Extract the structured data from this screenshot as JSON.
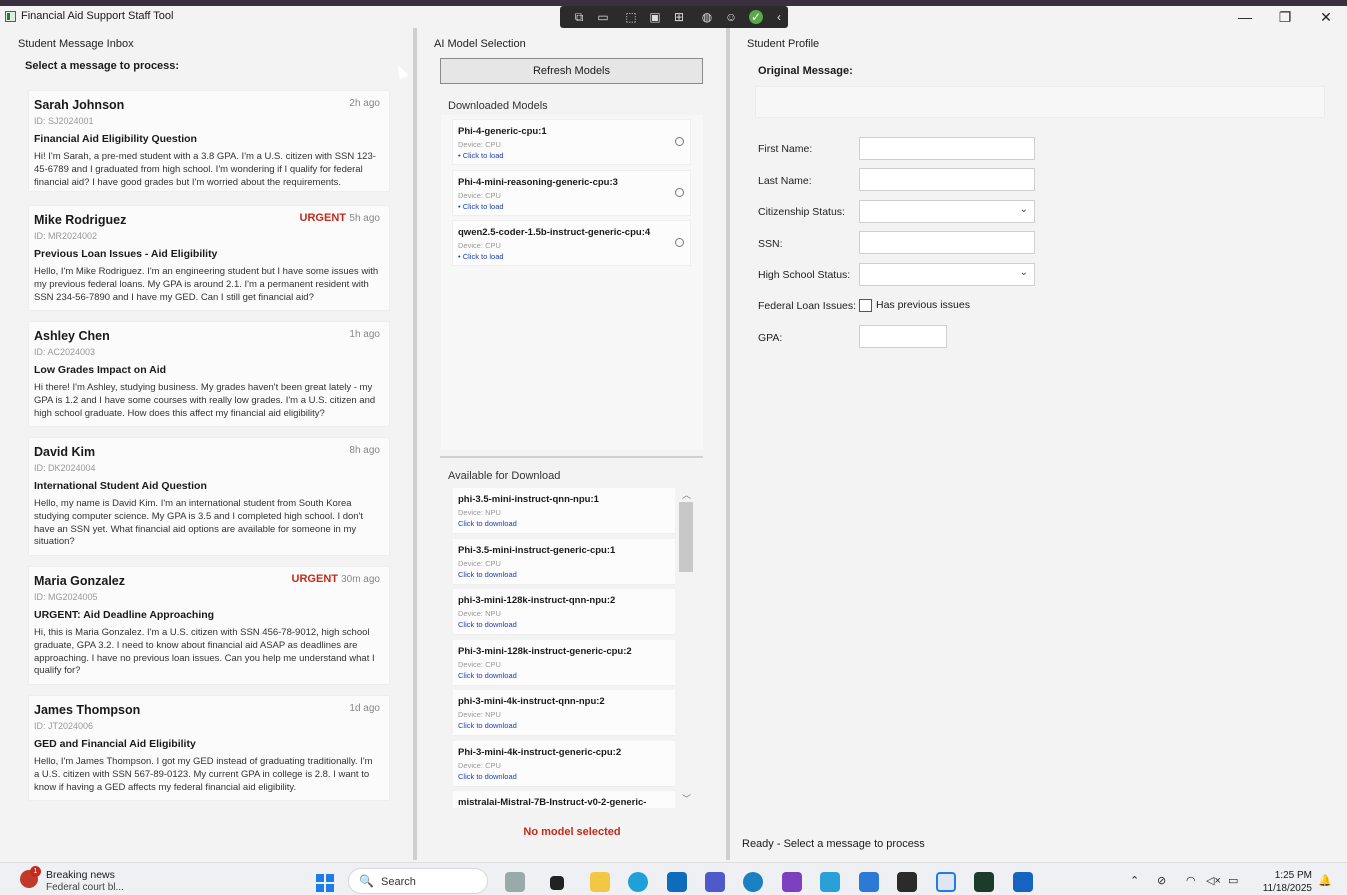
{
  "window": {
    "title": "Financial Aid Support Staff Tool",
    "minimize_glyph": "—",
    "restore_glyph": "❐",
    "close_glyph": "✕"
  },
  "capture_toolbar": {
    "icons": [
      "screen-record-icon",
      "camera-icon",
      "cursor-select-icon",
      "region-icon",
      "window-capture-icon",
      "mic-off-icon",
      "accessibility-icon",
      "check-icon",
      "collapse-icon"
    ]
  },
  "inbox": {
    "pane_label": "Student Message Inbox",
    "heading": "Select a message to process:",
    "urgent_label": "URGENT",
    "messages": [
      {
        "name": "Sarah Johnson",
        "id": "ID: SJ2024001",
        "time": "2h ago",
        "urgent": false,
        "subject": "Financial Aid Eligibility Question",
        "body": "Hi! I'm Sarah, a pre-med student with a 3.8 GPA. I'm a U.S. citizen with SSN 123-45-6789 and I graduated from high school. I'm wondering if I qualify for federal financial aid? I have good grades but I'm worried about the requirements."
      },
      {
        "name": "Mike Rodriguez",
        "id": "ID: MR2024002",
        "time": "5h ago",
        "urgent": true,
        "subject": "Previous Loan Issues - Aid Eligibility",
        "body": "Hello, I'm Mike Rodriguez. I'm an engineering student but I have some issues with my previous federal loans. My GPA is around 2.1. I'm a permanent resident with SSN 234-56-7890 and I have my GED. Can I still get financial aid?"
      },
      {
        "name": "Ashley Chen",
        "id": "ID: AC2024003",
        "time": "1h ago",
        "urgent": false,
        "subject": "Low Grades Impact on Aid",
        "body": "Hi there! I'm Ashley, studying business. My grades haven't been great lately - my GPA is 1.2 and I have some courses with really low grades. I'm a U.S. citizen and high school graduate. How does this affect my financial aid eligibility?"
      },
      {
        "name": "David Kim",
        "id": "ID: DK2024004",
        "time": "8h ago",
        "urgent": false,
        "subject": "International Student Aid Question",
        "body": "Hello, my name is David Kim. I'm an international student from South Korea studying computer science. My GPA is 3.5 and I completed high school. I don't have an SSN yet. What financial aid options are available for someone in my situation?"
      },
      {
        "name": "Maria Gonzalez",
        "id": "ID: MG2024005",
        "time": "30m ago",
        "urgent": true,
        "subject": "URGENT: Aid Deadline Approaching",
        "body": "Hi, this is Maria Gonzalez. I'm a U.S. citizen with SSN 456-78-9012, high school graduate, GPA 3.2. I need to know about financial aid ASAP as deadlines are approaching. I have no previous loan issues. Can you help me understand what I qualify for?"
      },
      {
        "name": "James Thompson",
        "id": "ID: JT2024006",
        "time": "1d ago",
        "urgent": false,
        "subject": "GED and Financial Aid Eligibility",
        "body": "Hello, I'm James Thompson. I got my GED instead of graduating traditionally. I'm a U.S. citizen with SSN 567-89-0123. My current GPA in college is 2.8. I want to know if having a GED affects my federal financial aid eligibility."
      }
    ]
  },
  "models": {
    "pane_label": "AI Model Selection",
    "refresh_label": "Refresh Models",
    "downloaded_label": "Downloaded Models",
    "downloaded": [
      {
        "name": "Phi-4-generic-cpu:1",
        "device": "Device: CPU",
        "action": "• Click to load"
      },
      {
        "name": "Phi-4-mini-reasoning-generic-cpu:3",
        "device": "Device: CPU",
        "action": "• Click to load"
      },
      {
        "name": "qwen2.5-coder-1.5b-instruct-generic-cpu:4",
        "device": "Device: CPU",
        "action": "• Click to load"
      }
    ],
    "available_label": "Available for Download",
    "available": [
      {
        "name": "phi-3.5-mini-instruct-qnn-npu:1",
        "device": "Device: NPU",
        "action": "Click to download"
      },
      {
        "name": "Phi-3.5-mini-instruct-generic-cpu:1",
        "device": "Device: CPU",
        "action": "Click to download"
      },
      {
        "name": "phi-3-mini-128k-instruct-qnn-npu:2",
        "device": "Device: NPU",
        "action": "Click to download"
      },
      {
        "name": "Phi-3-mini-128k-instruct-generic-cpu:2",
        "device": "Device: CPU",
        "action": "Click to download"
      },
      {
        "name": "phi-3-mini-4k-instruct-qnn-npu:2",
        "device": "Device: NPU",
        "action": "Click to download"
      },
      {
        "name": "Phi-3-mini-4k-instruct-generic-cpu:2",
        "device": "Device: CPU",
        "action": "Click to download"
      },
      {
        "name": "mistralai-Mistral-7B-Instruct-v0-2-generic-",
        "device": "",
        "action": ""
      }
    ],
    "no_model_text": "No model selected"
  },
  "profile": {
    "pane_label": "Student Profile",
    "original_label": "Original Message:",
    "first_name_label": "First Name:",
    "last_name_label": "Last Name:",
    "citizenship_label": "Citizenship Status:",
    "ssn_label": "SSN:",
    "high_school_label": "High School Status:",
    "loan_label": "Federal Loan Issues:",
    "loan_checkbox_label": "Has previous issues",
    "gpa_label": "GPA:"
  },
  "status": {
    "text": "Ready - Select a message to process"
  },
  "taskbar": {
    "news_title": "Breaking news",
    "news_sub": "Federal court bl...",
    "news_badge": "1",
    "search_label": "Search",
    "search_icon": "🔍",
    "time": "1:25 PM",
    "date": "11/18/2025",
    "colors": {
      "accent": "#1f7de8",
      "urgent": "#c42b1c",
      "link": "#1a3fb8"
    }
  }
}
